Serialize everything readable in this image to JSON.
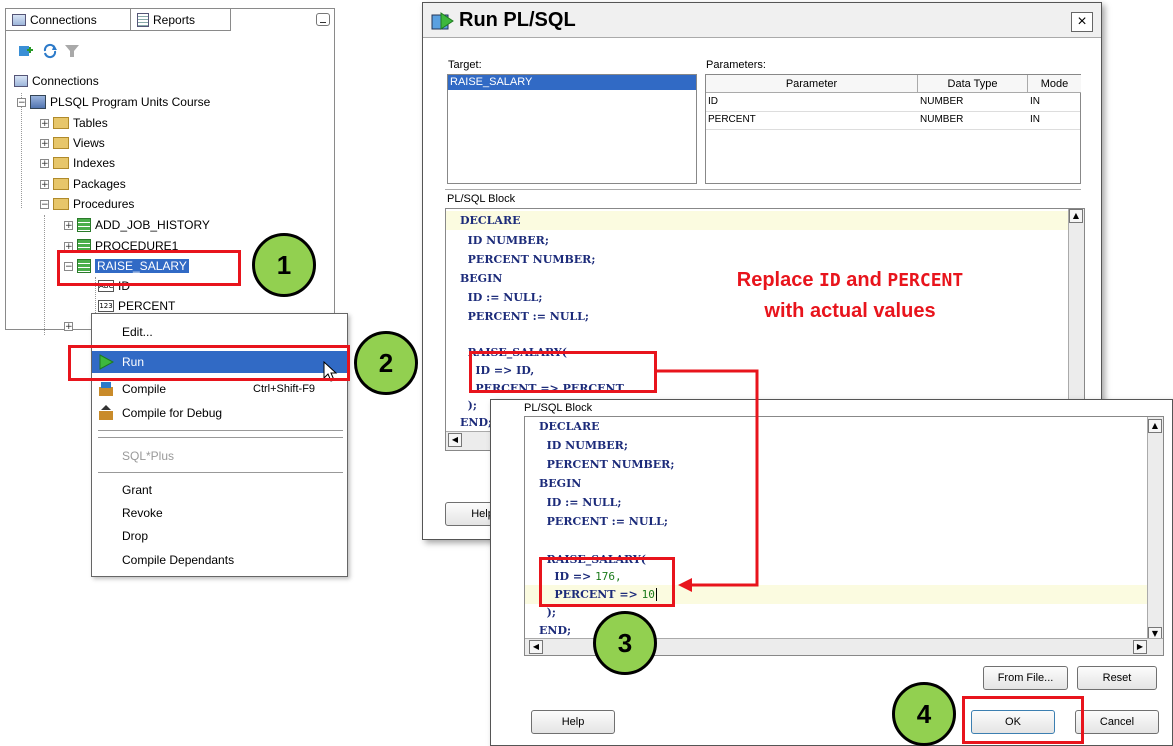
{
  "connections_panel": {
    "tabs": [
      "Connections",
      "Reports"
    ],
    "tree": {
      "root": "Connections",
      "connection": "PLSQL Program Units Course",
      "nodes": [
        "Tables",
        "Views",
        "Indexes",
        "Packages",
        "Procedures"
      ],
      "procedures": [
        "ADD_JOB_HISTORY",
        "PROCEDURE1",
        "RAISE_SALARY"
      ],
      "params": [
        "ID",
        "PERCENT"
      ],
      "param_icon_labels": [
        "ABC",
        "123"
      ]
    }
  },
  "context_menu": {
    "items": [
      {
        "label": "Edit..."
      },
      {
        "label": "Run",
        "highlighted": true
      },
      {
        "label": "Compile",
        "shortcut": "Ctrl+Shift-F9"
      },
      {
        "label": "Compile for Debug"
      },
      {
        "label": "SQL*Plus",
        "disabled": true
      },
      {
        "label": "Grant"
      },
      {
        "label": "Revoke"
      },
      {
        "label": "Drop"
      },
      {
        "label": "Compile Dependants"
      }
    ]
  },
  "run_dialog": {
    "title": "Run PL/SQL",
    "close": "×",
    "target_label": "Target:",
    "target_value": "RAISE_SALARY",
    "parameters_label": "Parameters:",
    "param_headers": [
      "Parameter",
      "Data Type",
      "Mode"
    ],
    "param_rows": [
      {
        "name": "ID",
        "type": "NUMBER",
        "mode": "IN"
      },
      {
        "name": "PERCENT",
        "type": "NUMBER",
        "mode": "IN"
      }
    ],
    "block_label": "PL/SQL Block",
    "code": [
      "DECLARE",
      "  ID NUMBER;",
      "  PERCENT NUMBER;",
      "BEGIN",
      "  ID := NULL;",
      "  PERCENT := NULL;",
      "",
      "  RAISE_SALARY(",
      "    ID => ID,",
      "    PERCENT => PERCENT",
      "  );",
      "END;"
    ],
    "help_label": "Help"
  },
  "block_dialog": {
    "block_label": "PL/SQL Block",
    "code": [
      "DECLARE",
      "  ID NUMBER;",
      "  PERCENT NUMBER;",
      "BEGIN",
      "  ID := NULL;",
      "  PERCENT := NULL;",
      "",
      "  RAISE_SALARY("
    ],
    "edited_lines": [
      {
        "prefix": "    ID => ",
        "value": "176,"
      },
      {
        "prefix": "    PERCENT => ",
        "value": "10"
      }
    ],
    "tail_code": [
      "  );",
      "END;"
    ],
    "from_file_label": "From File...",
    "reset_label": "Reset",
    "help_label": "Help",
    "ok_label": "OK",
    "cancel_label": "Cancel"
  },
  "annotations": {
    "steps": [
      "1",
      "2",
      "3",
      "4"
    ],
    "note_line1_prefix": "Replace ",
    "note_id": "ID",
    "note_and": " and ",
    "note_percent": "PERCENT",
    "note_line2": "with actual values",
    "colors": {
      "highlight": "#e8141c",
      "step_circle": "#92d050",
      "menu_selection": "#316ac5"
    }
  }
}
